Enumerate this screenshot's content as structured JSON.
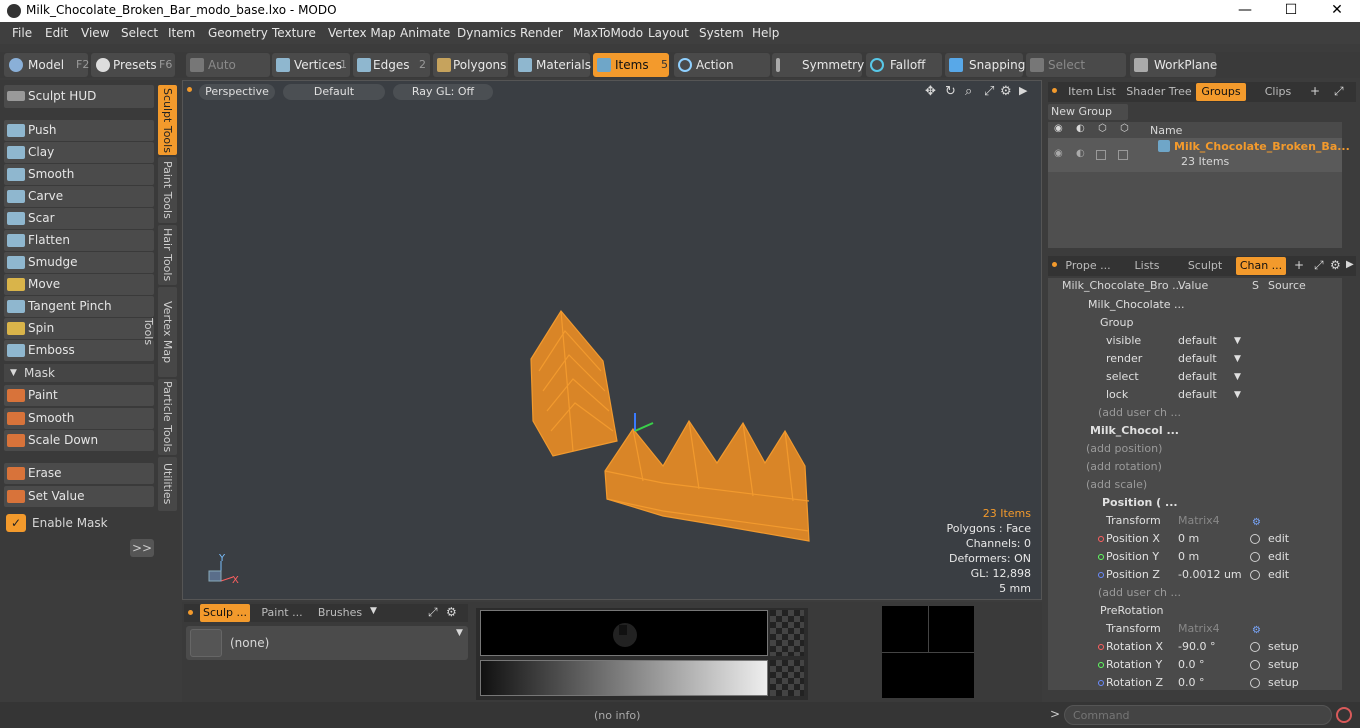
{
  "window": {
    "title": "Milk_Chocolate_Broken_Bar_modo_base.lxo - MODO",
    "minimize": "—",
    "maximize": "☐",
    "close": "✕"
  },
  "menu": [
    "File",
    "Edit",
    "View",
    "Select",
    "Item",
    "Geometry",
    "Texture",
    "Vertex Map",
    "Animate",
    "Dynamics",
    "Render",
    "MaxToModo",
    "Layout",
    "System",
    "Help"
  ],
  "toolbar": {
    "model": "Model",
    "model_key": "F2",
    "presets": "Presets",
    "presets_key": "F6",
    "auto_select": "Auto Select",
    "vertices": "Vertices",
    "vertices_key": "1",
    "edges": "Edges",
    "edges_key": "2",
    "polygons": "Polygons",
    "materials": "Materials",
    "items": "Items",
    "items_key": "5",
    "action_center": "Action Center",
    "symmetry": "Symmetry",
    "falloff": "Falloff",
    "snapping": "Snapping",
    "select_through": "Select Through",
    "workplane": "WorkPlane"
  },
  "left": {
    "sculpt_hud": "Sculpt HUD",
    "tools": [
      "Push",
      "Clay",
      "Smooth",
      "Carve",
      "Scar",
      "Flatten",
      "Smudge",
      "Move",
      "Tangent Pinch",
      "Spin",
      "Emboss"
    ],
    "mask_header": "Mask",
    "mask_tools": [
      "Paint",
      "Smooth",
      "Scale Down"
    ],
    "other_tools": [
      "Erase",
      "Set Value"
    ],
    "enable_mask": "Enable Mask",
    "more": ">>",
    "vtabs": [
      "Sculpt Tools",
      "Paint Tools",
      "Hair Tools",
      "Vertex Map Tools",
      "Particle Tools",
      "Utilities"
    ]
  },
  "viewport": {
    "view": "Perspective",
    "style": "Default",
    "raygl": "Ray GL: Off",
    "items": "23 Items",
    "polygons": "Polygons : Face",
    "channels": "Channels: 0",
    "deformers": "Deformers: ON",
    "gl": "GL: 12,898",
    "scale": "5 mm",
    "axis_y": "Y",
    "axis_x": "X"
  },
  "right_top": {
    "tabs": [
      "Item List",
      "Shader Tree",
      "Groups",
      "Clips"
    ],
    "new_group": "New Group",
    "name_col": "Name",
    "group_name": "Milk_Chocolate_Broken_Ba...",
    "group_count": "23 Items"
  },
  "right_bottom": {
    "tabs": [
      "Prope ...",
      "Lists",
      "Sculpt",
      "Chan ..."
    ],
    "col_name": "Milk_Chocolate_Bro ...",
    "col_value": "Value",
    "col_s": "S",
    "col_source": "Source",
    "rows": [
      {
        "name": "Milk_Chocolate ...",
        "value": "",
        "source": ""
      },
      {
        "name": "Group",
        "value": "",
        "source": ""
      },
      {
        "name": "visible",
        "value": "default",
        "source": ""
      },
      {
        "name": "render",
        "value": "default",
        "source": ""
      },
      {
        "name": "select",
        "value": "default",
        "source": ""
      },
      {
        "name": "lock",
        "value": "default",
        "source": ""
      },
      {
        "name": "(add user ch ...",
        "value": "",
        "source": ""
      },
      {
        "name": "Milk_Chocol ...",
        "value": "",
        "source": ""
      },
      {
        "name": "(add position)",
        "value": "",
        "source": ""
      },
      {
        "name": "(add rotation)",
        "value": "",
        "source": ""
      },
      {
        "name": "(add scale)",
        "value": "",
        "source": ""
      },
      {
        "name": "Position ( ...",
        "value": "",
        "source": ""
      },
      {
        "name": "Transform",
        "value": "Matrix4",
        "source": ""
      },
      {
        "name": "Position X",
        "value": "0 m",
        "source": "edit"
      },
      {
        "name": "Position Y",
        "value": "0 m",
        "source": "edit"
      },
      {
        "name": "Position Z",
        "value": "-0.0012 um",
        "source": "edit"
      },
      {
        "name": "(add user ch ...",
        "value": "",
        "source": ""
      },
      {
        "name": "PreRotation",
        "value": "",
        "source": ""
      },
      {
        "name": "Transform",
        "value": "Matrix4",
        "source": ""
      },
      {
        "name": "Rotation X",
        "value": "-90.0 °",
        "source": "setup"
      },
      {
        "name": "Rotation Y",
        "value": "0.0 °",
        "source": "setup"
      },
      {
        "name": "Rotation Z",
        "value": "0.0 °",
        "source": "setup"
      }
    ]
  },
  "bottom": {
    "tabs": [
      "Sculp ...",
      "Paint ...",
      "Brushes"
    ],
    "none": "(none)"
  },
  "status": {
    "info": "(no info)",
    "command_placeholder": "Command",
    "prompt": ">"
  },
  "colors": {
    "accent": "#f39a2c",
    "object": "#f29a2e"
  }
}
